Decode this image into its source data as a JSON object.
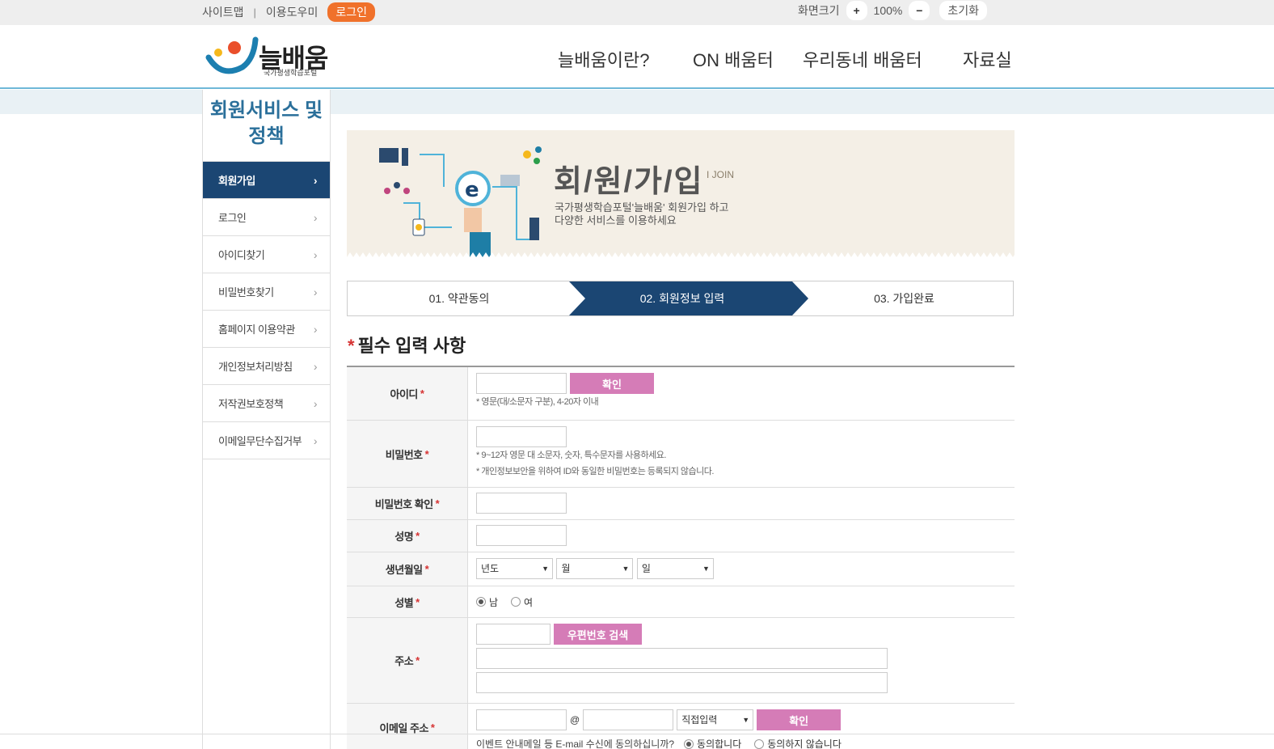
{
  "topbar": {
    "sitemap": "사이트맵",
    "separator": "|",
    "guide": "이용도우미",
    "login": "로그인",
    "zoom_label": "화면크기",
    "zoom_plus": "+",
    "zoom_value": "100%",
    "zoom_minus": "−",
    "zoom_reset": "초기화"
  },
  "header": {
    "logo_text": "늘배움",
    "logo_sub": "국가평생학습포털",
    "nav": [
      "늘배움이란?",
      "ON 배움터",
      "우리동네 배움터",
      "자료실"
    ]
  },
  "sidebar": {
    "title_line1": "회원서비스 및",
    "title_line2": "정책",
    "chevron": "›",
    "items": [
      {
        "label": "회원가입",
        "active": true
      },
      {
        "label": "로그인"
      },
      {
        "label": "아이디찾기"
      },
      {
        "label": "비밀번호찾기"
      },
      {
        "label": "홈페이지 이용약관"
      },
      {
        "label": "개인정보처리방침"
      },
      {
        "label": "저작권보호정책"
      },
      {
        "label": "이메일무단수집거부"
      }
    ]
  },
  "banner": {
    "title": "회/원/가/입",
    "sub": "I   JOIN",
    "desc_line1": "국가평생학습포털'늘배움' 회원가입 하고",
    "desc_line2": "다양한 서비스를 이용하세요"
  },
  "steps": {
    "items": [
      "01. 약관동의",
      "02. 회원정보 입력",
      "03. 가입완료"
    ],
    "active_index": 1,
    "active_color": "#1b4673"
  },
  "section": {
    "star": "*",
    "title": "필수 입력 사항"
  },
  "form": {
    "required_mark": "*",
    "id_label": "아이디",
    "id_check": "확인",
    "id_hint": "* 영문(대/소문자 구분), 4-20자 이내",
    "pw_label": "비밀번호",
    "pw_hint1": "* 9~12자 영문 대 소문자, 숫자, 특수문자를 사용하세요.",
    "pw_hint2": "* 개인정보보안을 위하여 ID와 동일한 비밀번호는 등록되지 않습니다.",
    "pw_confirm_label": "비밀번호 확인",
    "name_label": "성명",
    "birth_label": "생년월일",
    "birth_year": "년도",
    "birth_month": "월",
    "birth_day": "일",
    "select_arrow": "▼",
    "gender_label": "성별",
    "gender_male": "남",
    "gender_female": "여",
    "address_label": "주소",
    "zip_search": "우편번호 검색",
    "email_label": "이메일 주소",
    "email_at": "@",
    "email_domain_select": "직접입력",
    "email_check": "확인",
    "email_consent": "이벤트 안내메일 등 E-mail 수신에 동의하십니까?",
    "email_agree": "동의합니다",
    "email_disagree": "동의하지 않습니다"
  },
  "colors": {
    "accent_orange": "#f0712b",
    "navy": "#1b4673",
    "pink_button": "#d57cb7",
    "required_red": "#d63333"
  }
}
